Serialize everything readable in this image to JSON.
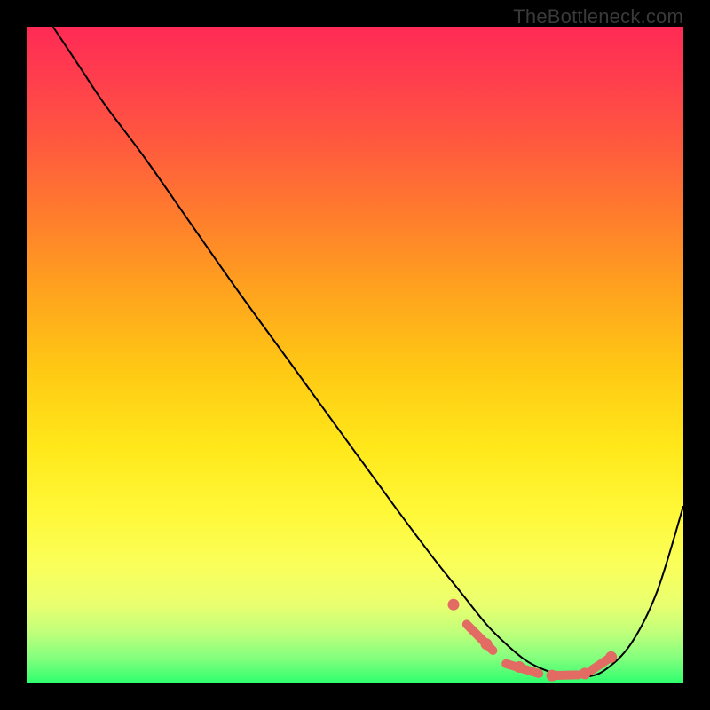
{
  "watermark": "TheBottleneck.com",
  "colors": {
    "gradient_top": "#ff2a55",
    "gradient_bottom": "#2eff6e",
    "curve": "#000000",
    "markers": "#e26b63",
    "frame": "#000000"
  },
  "chart_data": {
    "type": "line",
    "title": "",
    "xlabel": "",
    "ylabel": "",
    "xlim": [
      0,
      100
    ],
    "ylim": [
      0,
      100
    ],
    "grid": false,
    "legend": false,
    "series": [
      {
        "name": "bottleneck-curve",
        "x": [
          4,
          8,
          12,
          18,
          25,
          32,
          40,
          48,
          56,
          62,
          66,
          70,
          73,
          76,
          79,
          82,
          85,
          88,
          92,
          96,
          100
        ],
        "y": [
          100,
          94,
          88,
          80,
          70,
          60,
          49,
          38,
          27,
          19,
          14,
          9,
          6,
          3.5,
          2,
          1.2,
          1,
          2,
          6,
          14,
          27
        ]
      }
    ],
    "markers": {
      "note": "Highlighted low-bottleneck region near the valley floor",
      "points": [
        {
          "x": 65,
          "y": 12
        },
        {
          "x": 70,
          "y": 6
        },
        {
          "x": 75,
          "y": 2.5
        },
        {
          "x": 80,
          "y": 1.2
        },
        {
          "x": 85,
          "y": 1.5
        },
        {
          "x": 89,
          "y": 4
        }
      ],
      "segments": [
        {
          "x1": 67,
          "y1": 9,
          "x2": 71,
          "y2": 5
        },
        {
          "x1": 73,
          "y1": 3,
          "x2": 78,
          "y2": 1.5
        },
        {
          "x1": 80,
          "y1": 1.2,
          "x2": 84,
          "y2": 1.3
        },
        {
          "x1": 86,
          "y1": 2,
          "x2": 89,
          "y2": 4
        }
      ]
    }
  }
}
